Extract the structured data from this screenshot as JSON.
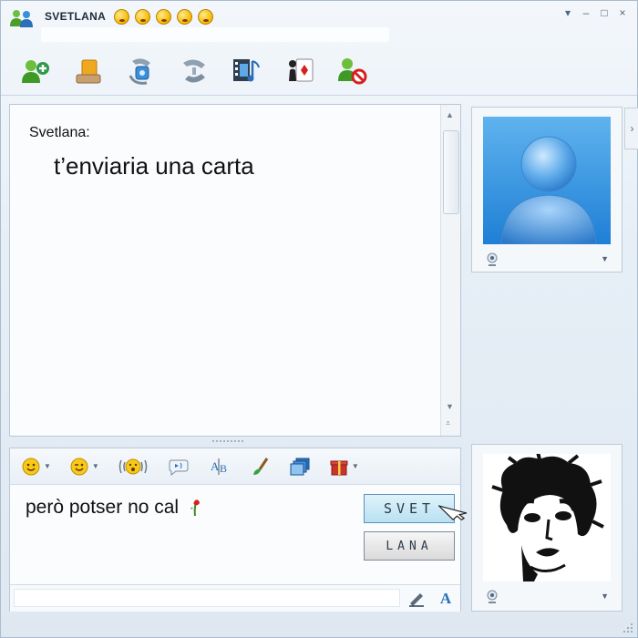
{
  "window": {
    "title": "SVETLANA",
    "title_emoticons": [
      "blush-emoticon",
      "blush-emoticon",
      "blush-emoticon",
      "blush-emoticon",
      "blush-emoticon"
    ],
    "controls": {
      "menu": "▾",
      "minimize": "–",
      "maximize": "□",
      "close": "×"
    }
  },
  "toolbar": {
    "items": [
      {
        "icon": "invite-contact-icon"
      },
      {
        "icon": "send-files-icon"
      },
      {
        "icon": "video-call-icon"
      },
      {
        "icon": "voice-call-icon"
      },
      {
        "icon": "activities-icon"
      },
      {
        "icon": "games-icon"
      },
      {
        "icon": "block-contact-icon"
      }
    ]
  },
  "conversation": {
    "sender": "Svetlana:",
    "message": "t’enviaria una carta"
  },
  "compose": {
    "format_buttons": [
      {
        "icon": "emoticon-icon",
        "dropdown": true
      },
      {
        "icon": "wink-icon",
        "dropdown": true
      },
      {
        "icon": "nudge-icon",
        "dropdown": false
      },
      {
        "icon": "voice-clip-icon",
        "dropdown": false
      },
      {
        "icon": "font-icon",
        "dropdown": false
      },
      {
        "icon": "background-brush-icon",
        "dropdown": false
      },
      {
        "icon": "gallery-icon",
        "dropdown": false
      },
      {
        "icon": "gift-icon",
        "dropdown": true
      }
    ],
    "text": "però potser no cal",
    "handwriting_button_1": "SVET",
    "handwriting_button_2": "LANA",
    "footer_tools": [
      "handwriting-pen-icon",
      "text-mode-icon"
    ],
    "text_mode_label": "A"
  },
  "contact_picture": {
    "icon": "default-user-avatar"
  },
  "user_picture": {
    "icon": "user-portrait"
  },
  "colors": {
    "accent": "#1f7fd6",
    "panel_border": "#b8c8d8",
    "handwriting_active": "#b9e1f2"
  }
}
